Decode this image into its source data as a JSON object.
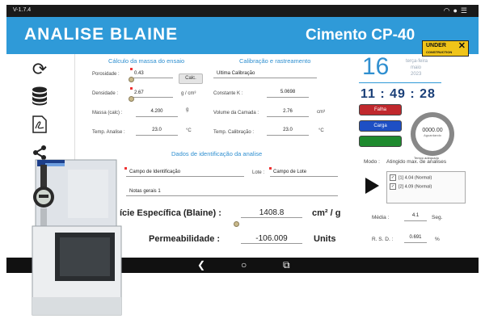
{
  "status": {
    "version": "V-1.7.4",
    "icons": [
      "wifi-icon",
      "android-icon",
      "menu-icon"
    ]
  },
  "header": {
    "title": "ANALISE BLAINE",
    "product": "Cimento CP-40",
    "badge_line1": "UNDER",
    "badge_line2": "CONSTRUCTION"
  },
  "sidebar": {
    "items": [
      "refresh-icon",
      "database-icon",
      "pdf-icon",
      "share-icon"
    ]
  },
  "mass": {
    "title": "Cálculo da massa do ensaio",
    "porosidade_label": "Porosidade :",
    "porosidade_value": "0.43",
    "calc_button": "Calc.",
    "densidade_label": "Densidade :",
    "densidade_value": "2.67",
    "densidade_unit": "g / cm³",
    "massa_label": "Massa (calc) :",
    "massa_value": "4.200",
    "massa_unit": "g",
    "temp_label": "Temp. Analise :",
    "temp_value": "23.0",
    "temp_unit": "°C"
  },
  "calib": {
    "title": "Calibração e rastreamento",
    "ultima": "Ultima Calibração",
    "constante_label": "Constante K :",
    "constante_value": "5.0698",
    "volume_label": "Volume da Camada :",
    "volume_value": "2.76",
    "volume_unit": "cm³",
    "temp_label": "Temp. Calibração :",
    "temp_value": "23.0",
    "temp_unit": "°C"
  },
  "ident": {
    "title": "Dados de identificação da analise",
    "campo_id": "Campo de Identificação",
    "lote_label": "Lote :",
    "lote_value": "Campo de Lote",
    "notas": "Notas gerais 1"
  },
  "results": {
    "blaine_label": "ície Específica (Blaine) :",
    "blaine_value": "1408.8",
    "blaine_unit": "cm² / g",
    "perm_label": "Permeabilidade :",
    "perm_value": "-106.009",
    "perm_unit": "Units"
  },
  "datetime": {
    "day": "16",
    "weekday": "terça-feira",
    "month": "maio",
    "year": "2023",
    "time": "11 : 49 : 28"
  },
  "status_buttons": {
    "falha": "Falha",
    "carga": "Carga",
    "green": ""
  },
  "colors": {
    "falha": "#c0282d",
    "carga": "#1e4fc4",
    "green": "#1e8a2e",
    "header": "#2f9ad8"
  },
  "timer": {
    "value": "0000.00",
    "label": "Aguardando",
    "caption": "Tempo adequado"
  },
  "mode": {
    "label": "Modo :",
    "value": "Atingido max. de analises"
  },
  "history": [
    {
      "check": "✓",
      "index": "[1]",
      "text": "4.04 (Normal)"
    },
    {
      "check": "✓",
      "index": "[2]",
      "text": "4.09 (Normal)"
    }
  ],
  "stats": {
    "media_label": "Média :",
    "media_value": "4.1",
    "media_unit": "Seg.",
    "rsd_label": "R. S. D. :",
    "rsd_value": "0.691",
    "rsd_unit": "%"
  },
  "nav": {
    "back": "❮",
    "home": "○",
    "recent": "⧉"
  }
}
